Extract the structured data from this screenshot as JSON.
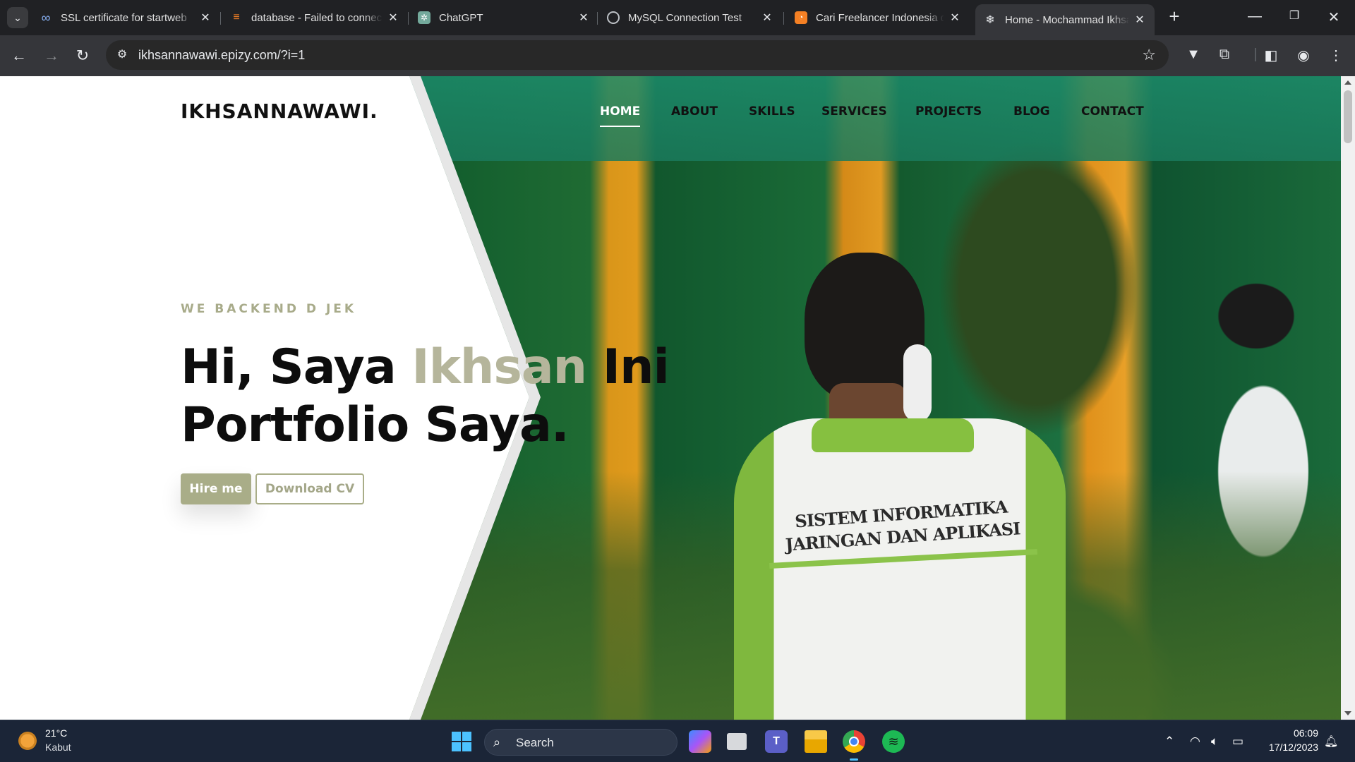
{
  "browser": {
    "tabs": [
      {
        "title": "SSL certificate for startweb",
        "icon": "infinity-icon",
        "color": "#8ab4f8"
      },
      {
        "title": "database - Failed to connect",
        "icon": "stackoverflow-icon",
        "color": "#f48024"
      },
      {
        "title": "ChatGPT",
        "icon": "chatgpt-icon",
        "color": "#74aa9c"
      },
      {
        "title": "MySQL Connection Test",
        "icon": "globe-icon",
        "color": "#bdc1c6"
      },
      {
        "title": "Cari Freelancer Indonesia dan",
        "icon": "freelancer-icon",
        "color": "#f48024"
      },
      {
        "title": "Home - Mochammad Ikhsan",
        "icon": "snowflake-icon",
        "color": "#e8eaed",
        "active": true
      }
    ],
    "url": "ikhsannawawi.epizy.com/?i=1"
  },
  "site": {
    "logo": "IKHSANNAWAWI.",
    "nav": [
      "HOME",
      "ABOUT",
      "SKILLS",
      "SERVICES",
      "PROJECTS",
      "BLOG",
      "CONTACT"
    ],
    "active_nav": "HOME",
    "eyebrow": "WE BACKEND D JEK",
    "headline_line1_pre": "Hi, Saya ",
    "headline_highlight": "Ikhsan",
    "headline_line1_post": " Ini",
    "headline_line2": "Portfolio Saya.",
    "hire_button": "Hire me",
    "cv_button": "Download CV",
    "jacket_text_line1": "SISTEM INFORMATIKA",
    "jacket_text_line2": "JARINGAN DAN APLIKASI",
    "accent_color": "#a9ad88"
  },
  "taskbar": {
    "weather_temp": "21°C",
    "weather_desc": "Kabut",
    "search_label": "Search",
    "apps": [
      "copilot-icon",
      "task-view-icon",
      "teams-icon",
      "file-explorer-icon",
      "chrome-icon",
      "spotify-icon"
    ],
    "time": "06:09",
    "date": "17/12/2023"
  }
}
